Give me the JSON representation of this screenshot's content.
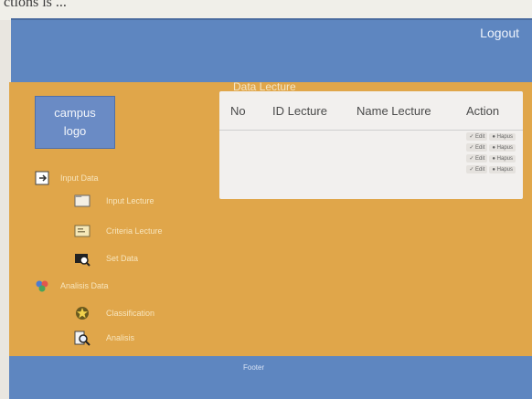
{
  "top_fragment": "ctions is ...",
  "header": {
    "logout_label": "Logout"
  },
  "sidebar": {
    "logo_text": "campus logo",
    "items": [
      {
        "label": "Input Data",
        "icon": "login-icon"
      },
      {
        "label": "Input Lecture",
        "icon": "folder-icon"
      },
      {
        "label": "Criteria Lecture",
        "icon": "card-icon"
      },
      {
        "label": "Set Data",
        "icon": "search-camera-icon"
      },
      {
        "label": "Analisis Data",
        "icon": "puzzle-icon"
      },
      {
        "label": "Classification",
        "icon": "star-icon"
      },
      {
        "label": "Analisis",
        "icon": "magnify-icon"
      }
    ]
  },
  "main": {
    "title": "Data Lecture",
    "table": {
      "columns": [
        "No",
        "ID Lecture",
        "Name Lecture",
        "Action"
      ],
      "actions": [
        {
          "edit": "Edit",
          "delete": "Hapus"
        },
        {
          "edit": "Edit",
          "delete": "Hapus"
        },
        {
          "edit": "Edit",
          "delete": "Hapus"
        },
        {
          "edit": "Edit",
          "delete": "Hapus"
        }
      ]
    }
  },
  "footer": {
    "label": "Footer"
  },
  "colors": {
    "header": "#5e86c0",
    "main": "#e0a64a",
    "panel": "#f2f0ee",
    "logo": "#6a8bc5"
  }
}
